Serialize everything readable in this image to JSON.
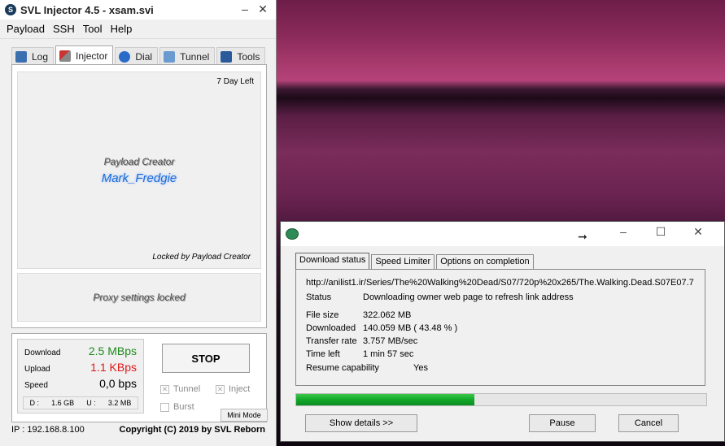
{
  "svl": {
    "title": "SVL Injector 4.5 - xsam.svi",
    "menu": [
      "Payload",
      "SSH",
      "Tool",
      "Help"
    ],
    "tabs": [
      "Log",
      "Injector",
      "Dial",
      "Tunnel",
      "Tools"
    ],
    "days_left": "7 Day Left",
    "payload_creator_label": "Payload Creator",
    "payload_creator_name": "Mark_Fredgie",
    "locked_text": "Locked by Payload Creator",
    "proxy_text": "Proxy settings locked",
    "stats": {
      "download_label": "Download",
      "download_value": "2.5 MBps",
      "upload_label": "Upload",
      "upload_value": "1.1 KBps",
      "speed_label": "Speed",
      "speed_value": "0,0 bps",
      "d_label": "D :",
      "d_value": "1.6 GB",
      "u_label": "U :",
      "u_value": "3.2 MB"
    },
    "stop_label": "STOP",
    "tunnel_label": "Tunnel",
    "inject_label": "Inject",
    "burst_label": "Burst",
    "mini_mode": "Mini Mode",
    "ip": "IP : 192.168.8.100",
    "copyright": "Copyright (C) 2019 by SVL Reborn",
    "colors": {
      "download": "#1d8a1d",
      "upload": "#e01818"
    }
  },
  "download": {
    "tabs": [
      "Download status",
      "Speed Limiter",
      "Options on completion"
    ],
    "url": "http://anilist1.ir/Series/The%20Walking%20Dead/S07/720p%20x265/The.Walking.Dead.S07E07.7",
    "status_label": "Status",
    "status_value": "Downloading owner web page to refresh link address",
    "file_size_label": "File size",
    "file_size_value": "322.062  MB",
    "downloaded_label": "Downloaded",
    "downloaded_value": "140.059  MB  ( 43.48 % )",
    "transfer_label": "Transfer rate",
    "transfer_value": "3.757  MB/sec",
    "time_left_label": "Time left",
    "time_left_value": "1 min 57 sec",
    "resume_label": "Resume capability",
    "resume_value": "Yes",
    "progress": 0.4348,
    "show_details": "Show details >>",
    "pause": "Pause",
    "cancel": "Cancel"
  }
}
